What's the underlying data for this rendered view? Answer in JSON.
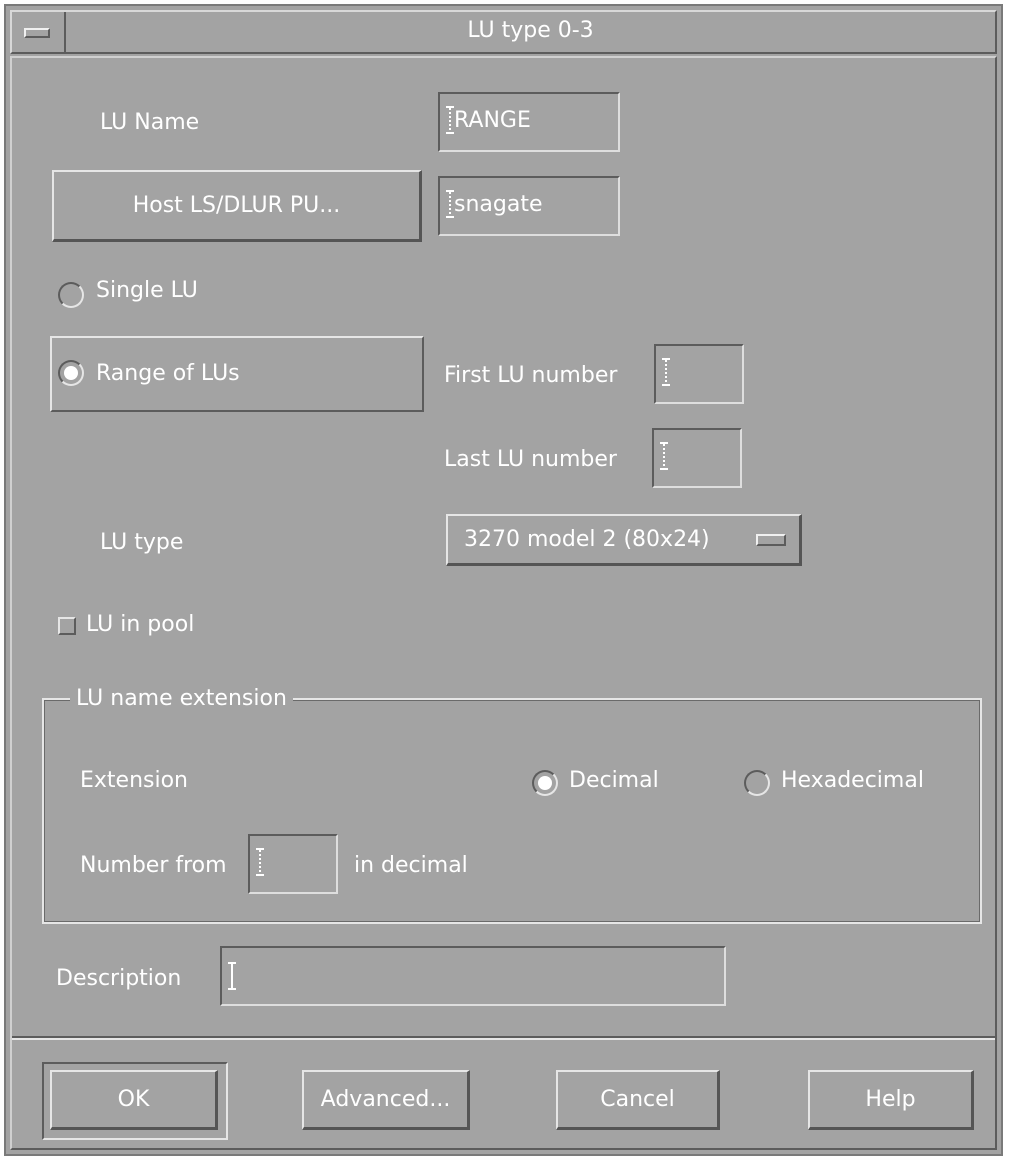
{
  "window": {
    "title": "LU type 0-3"
  },
  "form": {
    "lu_name_label": "LU Name",
    "lu_name_value": "RANGE",
    "host_button": "Host LS/DLUR PU...",
    "host_value": "snagate",
    "single_lu_label": "Single LU",
    "single_lu_selected": false,
    "range_lu_label": "Range of LUs",
    "range_lu_selected": true,
    "first_lu_label": "First LU number",
    "first_lu_value": "",
    "last_lu_label": "Last LU number",
    "last_lu_value": "",
    "lu_type_label": "LU type",
    "lu_type_value": "3270 model 2 (80x24)",
    "lu_in_pool_label": "LU in pool",
    "lu_in_pool_checked": false
  },
  "extension_group": {
    "title": "LU name extension",
    "extension_label": "Extension",
    "decimal_label": "Decimal",
    "decimal_selected": true,
    "hex_label": "Hexadecimal",
    "hex_selected": false,
    "number_from_label": "Number from",
    "number_from_value": "",
    "in_decimal_label": "in decimal"
  },
  "description": {
    "label": "Description",
    "value": ""
  },
  "buttons": {
    "ok": "OK",
    "advanced": "Advanced...",
    "cancel": "Cancel",
    "help": "Help"
  }
}
